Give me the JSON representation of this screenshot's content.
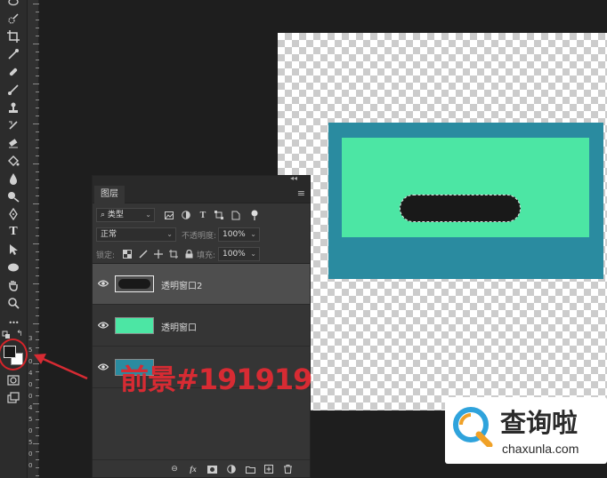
{
  "layers_panel": {
    "tab_label": "图层",
    "filter_kind": "类型",
    "blend_mode": "正常",
    "opacity_label": "不透明度:",
    "opacity_value": "100%",
    "lock_label": "锁定:",
    "fill_label": "填充:",
    "fill_value": "100%",
    "layers": [
      {
        "name": "透明窗口2",
        "selected": true,
        "visible": true
      },
      {
        "name": "透明窗口",
        "selected": false,
        "visible": true
      },
      {
        "name": "",
        "selected": false,
        "visible": true
      }
    ],
    "footer_icons": [
      "link-icon",
      "fx-icon",
      "mask-icon",
      "adjustment-icon",
      "group-icon",
      "new-layer-icon",
      "trash-icon"
    ],
    "footer_fx": "fx"
  },
  "toolbar": {
    "tools": [
      "lasso-icon",
      "quick-select-icon",
      "crop-icon",
      "eyedropper-icon",
      "healing-brush-icon",
      "brush-icon",
      "clone-stamp-icon",
      "history-brush-icon",
      "eraser-icon",
      "paint-bucket-icon",
      "blur-icon",
      "dodge-icon",
      "pen-icon",
      "type-icon",
      "path-select-icon",
      "ellipse-icon",
      "hand-icon",
      "zoom-icon",
      "more-icon"
    ],
    "type_glyph": "T",
    "more_glyph": "•••",
    "foreground_color": "#191919",
    "background_color": "#ffffff"
  },
  "ruler": {
    "numbers": [
      "3",
      "5",
      "0",
      "4",
      "0",
      "0",
      "4",
      "5",
      "0",
      "5",
      "0",
      "0"
    ]
  },
  "canvas": {
    "outer_color": "#2a8ba0",
    "inner_color": "#4ce6a4",
    "pill_color": "#191919"
  },
  "annotation": {
    "text": "前景#191919",
    "color": "#d72b33"
  },
  "watermark": {
    "cn": "查询啦",
    "en": "chaxunla.com"
  }
}
